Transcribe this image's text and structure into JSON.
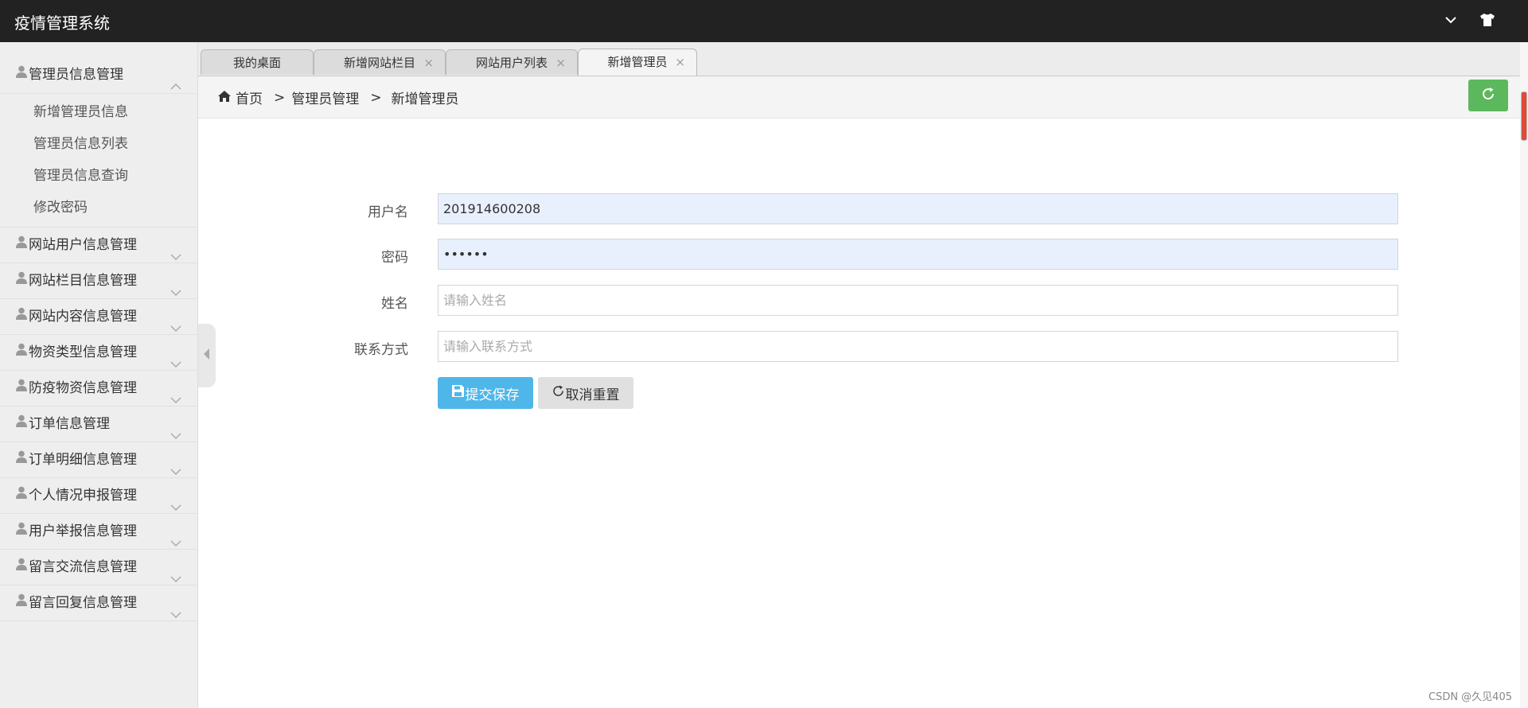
{
  "app": {
    "title": "疫情管理系统"
  },
  "sidebar": {
    "groups": [
      {
        "label": "管理员信息管理",
        "expanded": true,
        "items": [
          "新增管理员信息",
          "管理员信息列表",
          "管理员信息查询",
          "修改密码"
        ]
      },
      {
        "label": "网站用户信息管理"
      },
      {
        "label": "网站栏目信息管理"
      },
      {
        "label": "网站内容信息管理"
      },
      {
        "label": "物资类型信息管理"
      },
      {
        "label": "防疫物资信息管理"
      },
      {
        "label": "订单信息管理"
      },
      {
        "label": "订单明细信息管理"
      },
      {
        "label": "个人情况申报管理"
      },
      {
        "label": "用户举报信息管理"
      },
      {
        "label": "留言交流信息管理"
      },
      {
        "label": "留言回复信息管理"
      }
    ]
  },
  "tabs": [
    {
      "label": "我的桌面",
      "closable": false
    },
    {
      "label": "新增网站栏目",
      "closable": true
    },
    {
      "label": "网站用户列表",
      "closable": true
    },
    {
      "label": "新增管理员",
      "closable": true,
      "active": true
    }
  ],
  "tab_close_glyph": "×",
  "breadcrumb": {
    "home": "首页",
    "sep": ">",
    "level1": "管理员管理",
    "level2": "新增管理员"
  },
  "form": {
    "username": {
      "label": "用户名",
      "value": "201914600208"
    },
    "password": {
      "label": "密码",
      "value": "••••••"
    },
    "name": {
      "label": "姓名",
      "value": "",
      "placeholder": "请输入姓名"
    },
    "contact": {
      "label": "联系方式",
      "value": "",
      "placeholder": "请输入联系方式"
    },
    "save_label": "提交保存",
    "reset_label": "取消重置"
  },
  "watermark": "CSDN @久见405",
  "colors": {
    "topbar": "#222222",
    "refresh": "#5cb85c",
    "save": "#4fb6ea",
    "autofill": "#e8f0fe"
  },
  "icons": [
    "chevron-down-icon",
    "tshirt-icon",
    "user-icon",
    "chevron-up-icon",
    "home-icon",
    "refresh-icon",
    "save-icon",
    "reset-icon",
    "collapse-left-icon"
  ]
}
